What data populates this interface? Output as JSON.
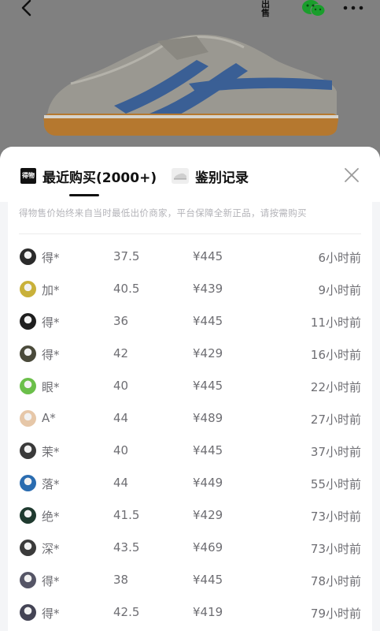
{
  "header": {
    "sell_label": "出售",
    "icons": [
      "back-icon",
      "wechat-icon",
      "more-icon"
    ]
  },
  "tabs": [
    {
      "label": "最近购买(2000+)",
      "icon_text": "得物"
    },
    {
      "label": "鉴别记录"
    }
  ],
  "notice": "得物售价始终来自当时最低出价商家，平台保障全新正品，请按需购买",
  "colors": {
    "overlay": "#808080",
    "text_primary": "#111111",
    "text_secondary": "#6e6e73",
    "notice": "#b3b3b8",
    "shoe_stripe": "#3a5f95",
    "shoe_sole": "#b5782f"
  },
  "purchases": [
    {
      "name": "得*",
      "size": "37.5",
      "price": "¥445",
      "time": "6小时前",
      "avatar": "#2b2b2b"
    },
    {
      "name": "加*",
      "size": "40.5",
      "price": "¥439",
      "time": "9小时前",
      "avatar": "#c9b13a"
    },
    {
      "name": "得*",
      "size": "36",
      "price": "¥445",
      "time": "11小时前",
      "avatar": "#1e1e1e"
    },
    {
      "name": "得*",
      "size": "42",
      "price": "¥429",
      "time": "16小时前",
      "avatar": "#4a4a3a"
    },
    {
      "name": "眼*",
      "size": "40",
      "price": "¥445",
      "time": "22小时前",
      "avatar": "#6bbf4a"
    },
    {
      "name": "A*",
      "size": "44",
      "price": "¥489",
      "time": "27小时前",
      "avatar": "#e6c7a8"
    },
    {
      "name": "茉*",
      "size": "40",
      "price": "¥445",
      "time": "37小时前",
      "avatar": "#3a3a3a"
    },
    {
      "name": "落*",
      "size": "44",
      "price": "¥449",
      "time": "55小时前",
      "avatar": "#2a6cb0"
    },
    {
      "name": "绝*",
      "size": "41.5",
      "price": "¥429",
      "time": "73小时前",
      "avatar": "#1f3a2f"
    },
    {
      "name": "深*",
      "size": "43.5",
      "price": "¥469",
      "time": "73小时前",
      "avatar": "#3b3b3b"
    },
    {
      "name": "得*",
      "size": "38",
      "price": "¥445",
      "time": "78小时前",
      "avatar": "#555566"
    },
    {
      "name": "得*",
      "size": "42.5",
      "price": "¥419",
      "time": "79小时前",
      "avatar": "#444455"
    }
  ]
}
